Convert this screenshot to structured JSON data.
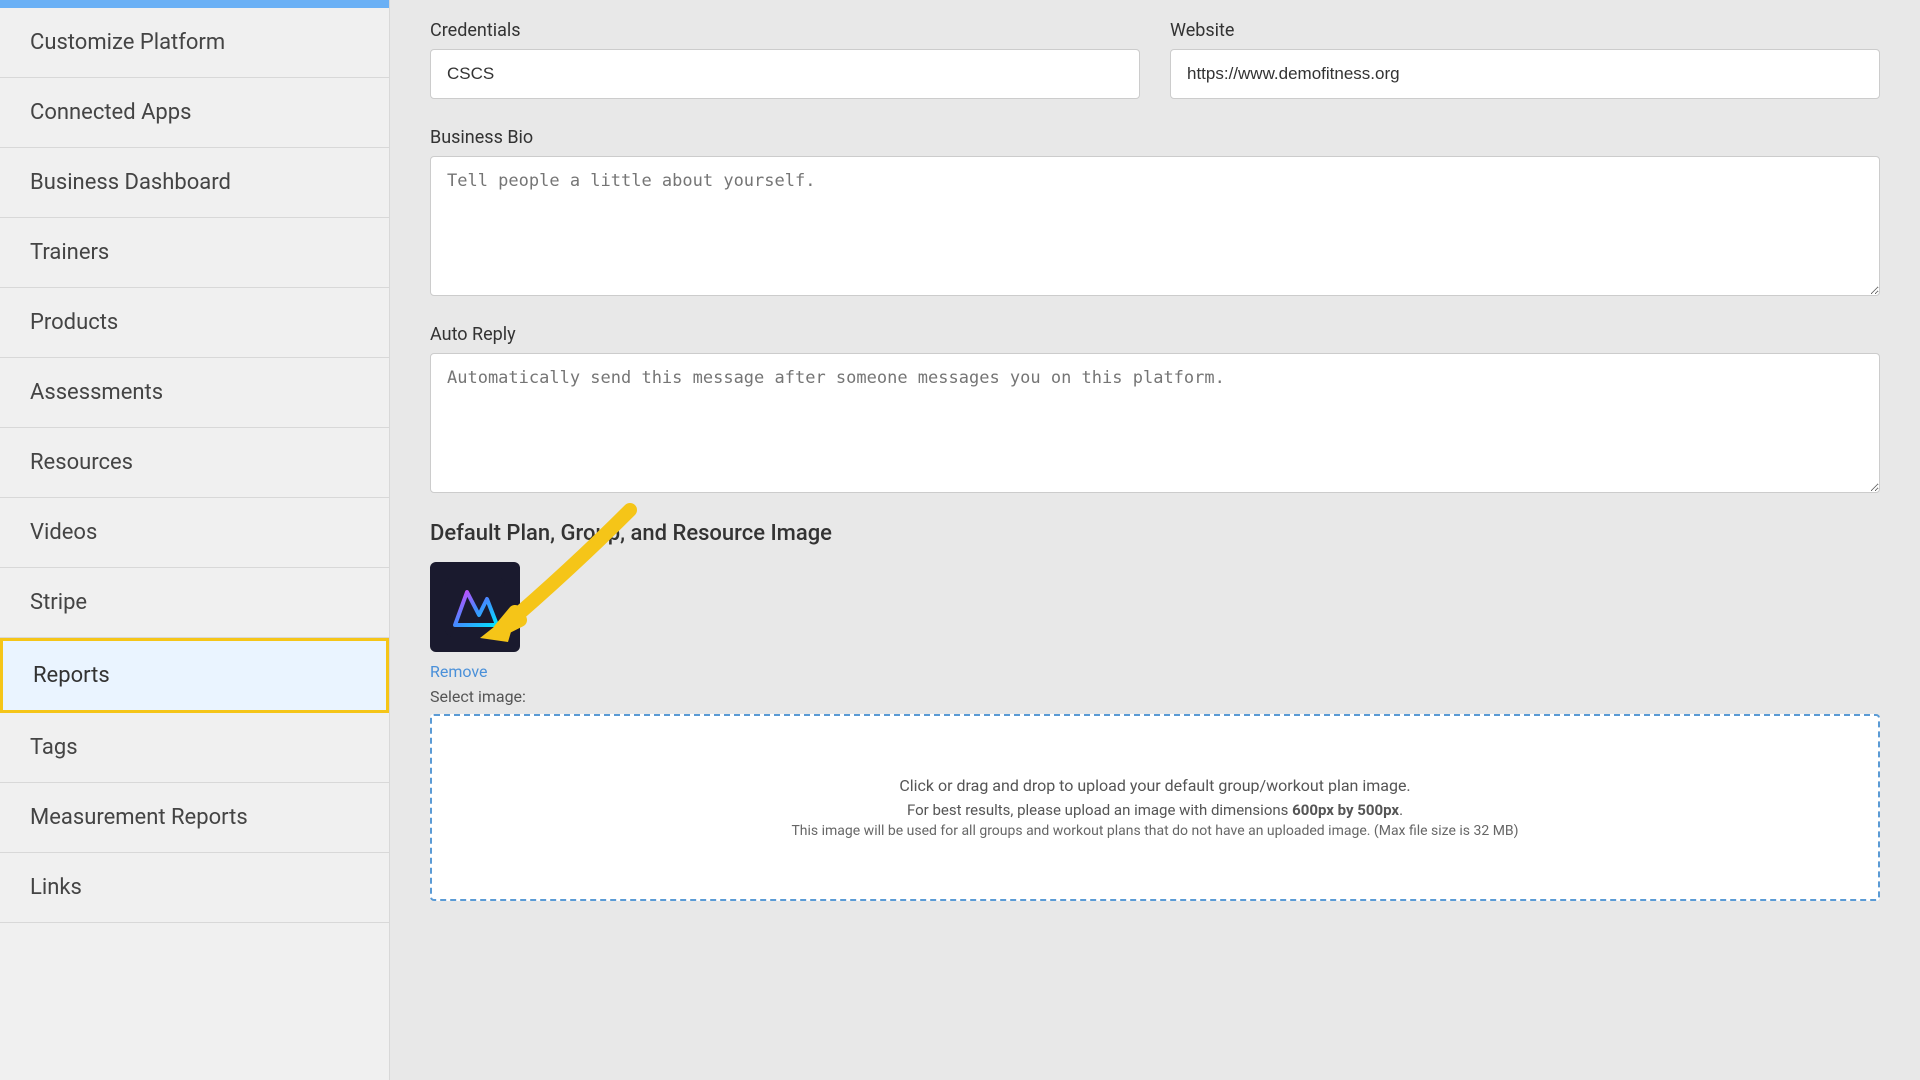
{
  "sidebar": {
    "items": [
      {
        "id": "customize-platform",
        "label": "Customize Platform",
        "active": false
      },
      {
        "id": "connected-apps",
        "label": "Connected Apps",
        "active": false
      },
      {
        "id": "business-dashboard",
        "label": "Business Dashboard",
        "active": false
      },
      {
        "id": "trainers",
        "label": "Trainers",
        "active": false
      },
      {
        "id": "products",
        "label": "Products",
        "active": false
      },
      {
        "id": "assessments",
        "label": "Assessments",
        "active": false
      },
      {
        "id": "resources",
        "label": "Resources",
        "active": false
      },
      {
        "id": "videos",
        "label": "Videos",
        "active": false
      },
      {
        "id": "stripe",
        "label": "Stripe",
        "active": false
      },
      {
        "id": "reports",
        "label": "Reports",
        "active": true
      },
      {
        "id": "tags",
        "label": "Tags",
        "active": false
      },
      {
        "id": "measurement-reports",
        "label": "Measurement Reports",
        "active": false
      },
      {
        "id": "links",
        "label": "Links",
        "active": false
      }
    ]
  },
  "form": {
    "credentials_label": "Credentials",
    "credentials_value": "CSCS",
    "website_label": "Website",
    "website_value": "https://www.demofitness.org",
    "bio_label": "Business Bio",
    "bio_placeholder": "Tell people a little about yourself.",
    "auto_reply_label": "Auto Reply",
    "auto_reply_placeholder": "Automatically send this message after someone messages you on this platform.",
    "default_image_label": "Default Plan, Group, and Resource Image",
    "remove_link": "Remove",
    "select_image_label": "Select image:",
    "upload_line1": "Click or drag and drop to upload your default group/workout plan image.",
    "upload_line2": "For best results, please upload an image with dimensions ",
    "upload_dimensions": "600px by 500px",
    "upload_line3": "This image will be used for all groups and workout plans that do not have an uploaded image. (Max file size is 32 MB)"
  }
}
